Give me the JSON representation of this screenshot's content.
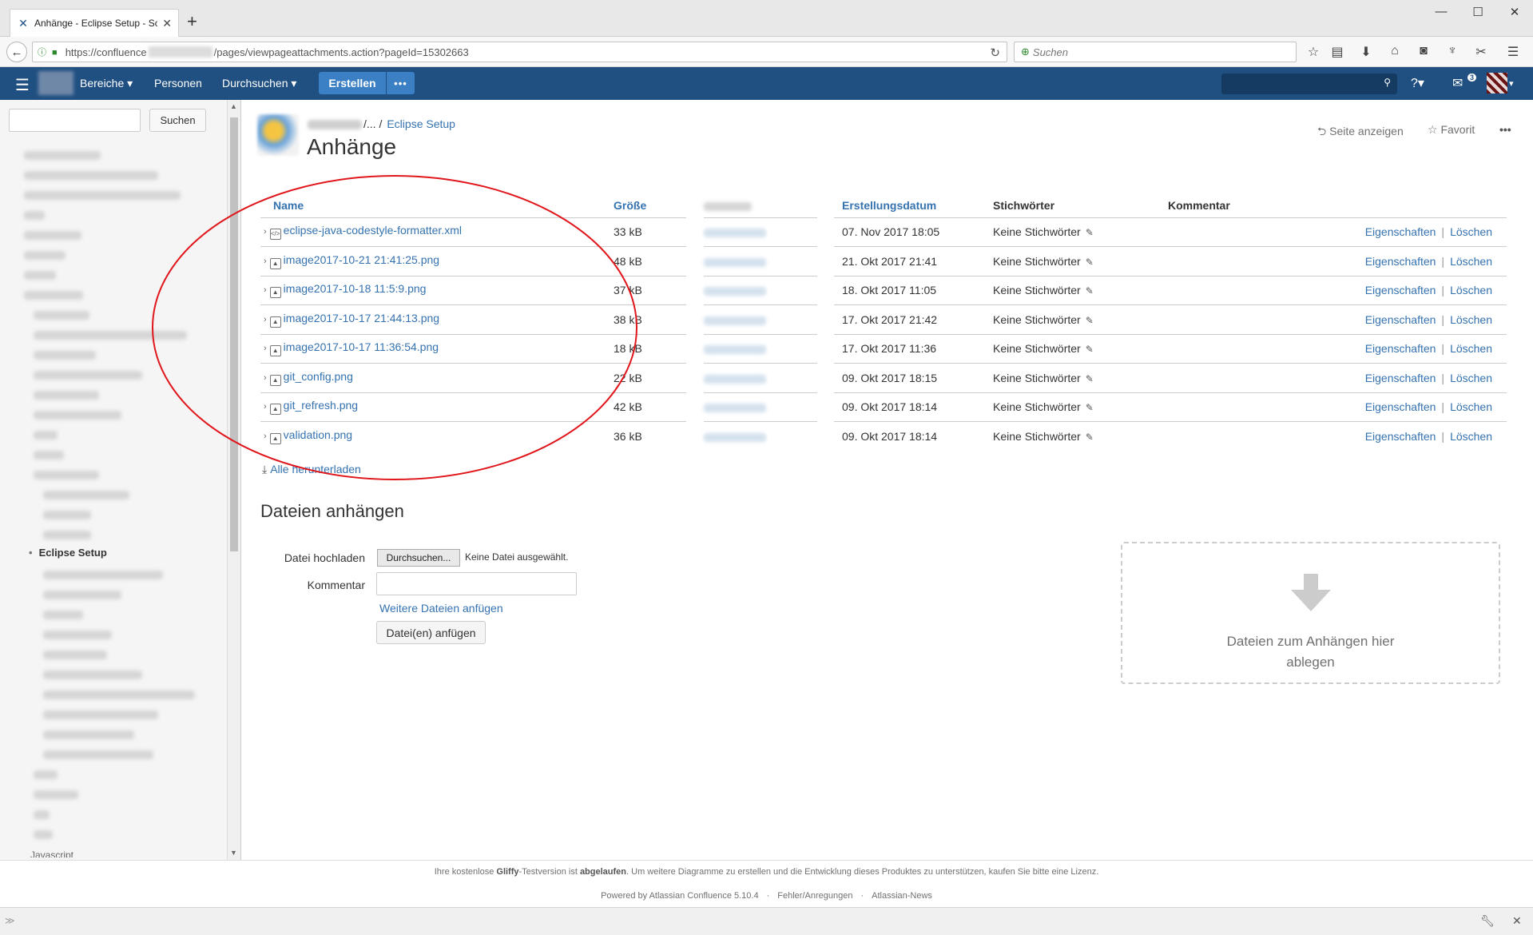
{
  "browser": {
    "tab_title": "Anhänge - Eclipse Setup - Sc",
    "url_prefix": "https://confluence",
    "url_suffix": "/pages/viewpageattachments.action?pageId=15302663",
    "search_placeholder": "Suchen"
  },
  "header": {
    "nav": [
      "Bereiche ▾",
      "Personen",
      "Durchsuchen ▾"
    ],
    "create_label": "Erstellen",
    "more_label": "•••",
    "notification_count": "3"
  },
  "sidebar": {
    "search_button": "Suchen",
    "current_page": "Eclipse Setup",
    "bottom_item": "Javascript"
  },
  "page": {
    "breadcrumb_sep": "/...  /",
    "breadcrumb_link": "Eclipse Setup",
    "title": "Anhänge",
    "actions": {
      "view": "Seite anzeigen",
      "favorite": "Favorit",
      "more": "•••"
    }
  },
  "table": {
    "headers": {
      "name": "Name",
      "size": "Größe",
      "created": "Erstellungsdatum",
      "tags": "Stichwörter",
      "comment": "Kommentar"
    },
    "rows": [
      {
        "name": "eclipse-java-codestyle-formatter.xml",
        "size": "33 kB",
        "date": "07. Nov 2017 18:05",
        "tags": "Keine Stichwörter",
        "icon": "xml-file-icon"
      },
      {
        "name": "image2017-10-21 21:41:25.png",
        "size": "48 kB",
        "date": "21. Okt 2017 21:41",
        "tags": "Keine Stichwörter",
        "icon": "image-file-icon"
      },
      {
        "name": "image2017-10-18 11:5:9.png",
        "size": "37 kB",
        "date": "18. Okt 2017 11:05",
        "tags": "Keine Stichwörter",
        "icon": "image-file-icon"
      },
      {
        "name": "image2017-10-17 21:44:13.png",
        "size": "38 kB",
        "date": "17. Okt 2017 21:42",
        "tags": "Keine Stichwörter",
        "icon": "image-file-icon"
      },
      {
        "name": "image2017-10-17 11:36:54.png",
        "size": "18 kB",
        "date": "17. Okt 2017 11:36",
        "tags": "Keine Stichwörter",
        "icon": "image-file-icon"
      },
      {
        "name": "git_config.png",
        "size": "22 kB",
        "date": "09. Okt 2017 18:15",
        "tags": "Keine Stichwörter",
        "icon": "image-file-icon"
      },
      {
        "name": "git_refresh.png",
        "size": "42 kB",
        "date": "09. Okt 2017 18:14",
        "tags": "Keine Stichwörter",
        "icon": "image-file-icon"
      },
      {
        "name": "validation.png",
        "size": "36 kB",
        "date": "09. Okt 2017 18:14",
        "tags": "Keine Stichwörter",
        "icon": "image-file-icon"
      }
    ],
    "action_properties": "Eigenschaften",
    "action_delete": "Löschen",
    "download_all": "Alle herunterladen"
  },
  "upload": {
    "title": "Dateien anhängen",
    "file_label": "Datei hochladen",
    "browse_button": "Durchsuchen...",
    "no_file": "Keine Datei ausgewählt.",
    "comment_label": "Kommentar",
    "more_files": "Weitere Dateien anfügen",
    "attach_button": "Datei(en) anfügen",
    "dropzone_text": "Dateien zum Anhängen hier ablegen"
  },
  "footer": {
    "notice_1": "Ihre kostenlose ",
    "notice_gliffy": "Gliffy",
    "notice_2": "-Testversion ist ",
    "notice_expired": "abgelaufen",
    "notice_3": ". Um weitere Diagramme zu erstellen und die Entwicklung dieses Produktes zu unterstützen, kaufen Sie bitte eine Lizenz.",
    "powered_by": "Powered by Atlassian Confluence 5.10.4",
    "feedback": "Fehler/Anregungen",
    "news": "Atlassian-News"
  },
  "colors": {
    "header_bg": "#205081",
    "link": "#3572b0",
    "create_bg": "#3b7fc4",
    "annotation": "#e0161b"
  }
}
